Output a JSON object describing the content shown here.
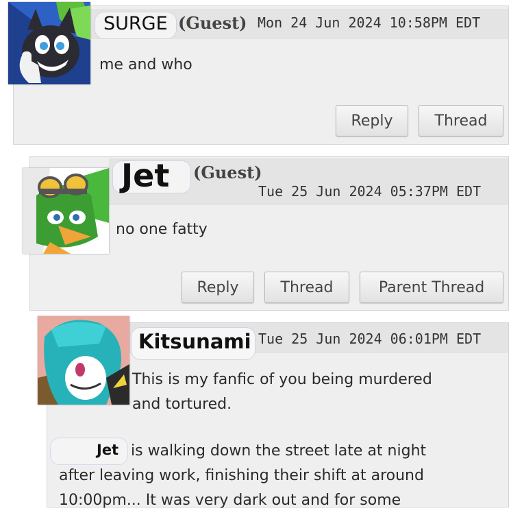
{
  "comments": [
    {
      "author": "SURGE",
      "guest_label": "(Guest)",
      "date": "Mon 24 Jun 2024 10:58PM EDT",
      "body": "me and who",
      "avatar_icon": "surge-avatar-icon",
      "buttons": [
        "Reply",
        "Thread"
      ]
    },
    {
      "author": "Jet",
      "guest_label": "(Guest)",
      "date": "Tue 25 Jun 2024 05:37PM EDT",
      "body": "no one fatty",
      "avatar_icon": "jet-avatar-icon",
      "buttons": [
        "Reply",
        "Thread",
        "Parent Thread"
      ]
    },
    {
      "author": "Kitsunami",
      "date": "Tue 25 Jun 2024 06:01PM EDT",
      "body_line1": "This is my fanfic of you being murdered",
      "body_line2": "and tortured.",
      "mention": "Jet",
      "para_line1": "is walking down the street late at night",
      "para_line2": "after leaving work, finishing their shift at around",
      "para_line3": "10:00pm... It was very dark out and for some",
      "avatar_icon": "kitsunami-avatar-icon"
    }
  ],
  "colors": {
    "panel": "#efefef",
    "header": "#e4e4e4",
    "surge_green": "#5fbf3a",
    "jet_green": "#49b83d",
    "kitsunami_teal": "#27b2b9"
  }
}
